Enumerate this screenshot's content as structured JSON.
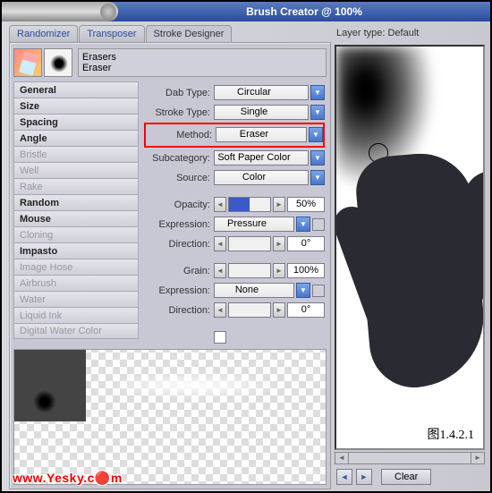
{
  "window": {
    "title": "Brush Creator @ 100%"
  },
  "tabs": {
    "randomizer": "Randomizer",
    "transposer": "Transposer",
    "stroke_designer": "Stroke Designer"
  },
  "brush": {
    "category": "Erasers",
    "variant": "Eraser"
  },
  "categories": [
    {
      "label": "General",
      "emph": true
    },
    {
      "label": "Size",
      "emph": true
    },
    {
      "label": "Spacing",
      "emph": true
    },
    {
      "label": "Angle",
      "emph": true
    },
    {
      "label": "Bristle",
      "dim": true
    },
    {
      "label": "Well",
      "dim": true
    },
    {
      "label": "Rake",
      "dim": true
    },
    {
      "label": "Random",
      "emph": true
    },
    {
      "label": "Mouse",
      "emph": true
    },
    {
      "label": "Cloning",
      "dim": true
    },
    {
      "label": "Impasto",
      "emph": true
    },
    {
      "label": "Image Hose",
      "dim": true
    },
    {
      "label": "Airbrush",
      "dim": true
    },
    {
      "label": "Water",
      "dim": true
    },
    {
      "label": "Liquid Ink",
      "dim": true
    },
    {
      "label": "Digital Water Color",
      "dim": true
    }
  ],
  "props": {
    "dab_type": {
      "label": "Dab Type:",
      "value": "Circular"
    },
    "stroke_type": {
      "label": "Stroke Type:",
      "value": "Single"
    },
    "method": {
      "label": "Method:",
      "value": "Eraser"
    },
    "subcategory": {
      "label": "Subcategory:",
      "value": "Soft Paper Color"
    },
    "source": {
      "label": "Source:",
      "value": "Color"
    },
    "opacity": {
      "label": "Opacity:",
      "value": "50%"
    },
    "expression1": {
      "label": "Expression:",
      "value": "Pressure"
    },
    "direction1": {
      "label": "Direction:",
      "value": "0°"
    },
    "grain": {
      "label": "Grain:",
      "value": "100%"
    },
    "expression2": {
      "label": "Expression:",
      "value": "None"
    },
    "direction2": {
      "label": "Direction:",
      "value": "0°"
    }
  },
  "right": {
    "layer_type_label": "Layer type:",
    "layer_type_value": "Default",
    "figure": "图1.4.2.1",
    "clear": "Clear"
  },
  "watermark": "www.Yesky.c🔴m"
}
